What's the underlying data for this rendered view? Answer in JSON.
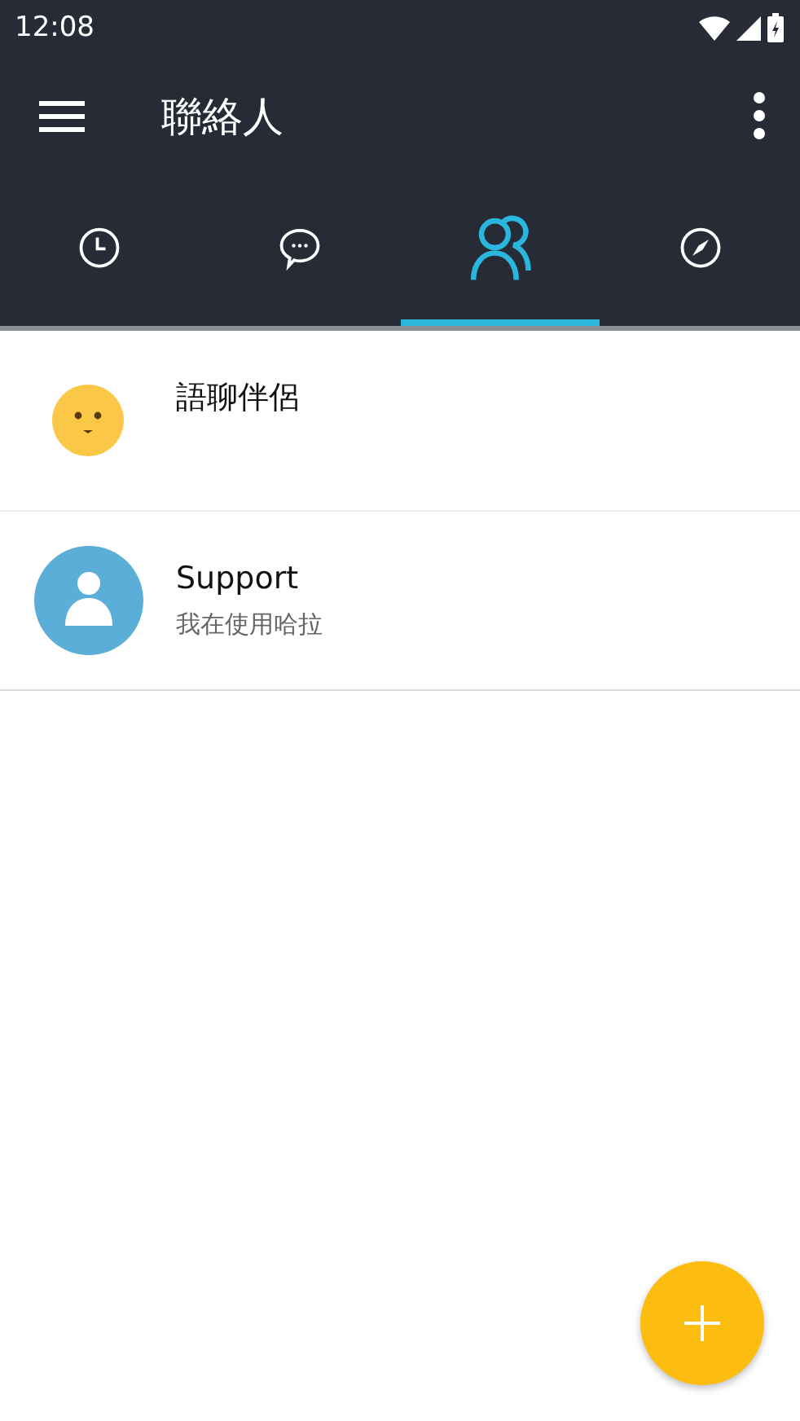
{
  "status_bar": {
    "time": "12:08"
  },
  "app_bar": {
    "title": "聯絡人"
  },
  "tabs": [
    {
      "kind": "recent",
      "selected": false
    },
    {
      "kind": "chats",
      "selected": false
    },
    {
      "kind": "contacts",
      "selected": true
    },
    {
      "kind": "discover",
      "selected": false
    }
  ],
  "contacts": [
    {
      "kind": "emoji",
      "name": "語聊伴侶"
    },
    {
      "kind": "person",
      "name": "Support",
      "status": "我在使用哈拉"
    }
  ]
}
